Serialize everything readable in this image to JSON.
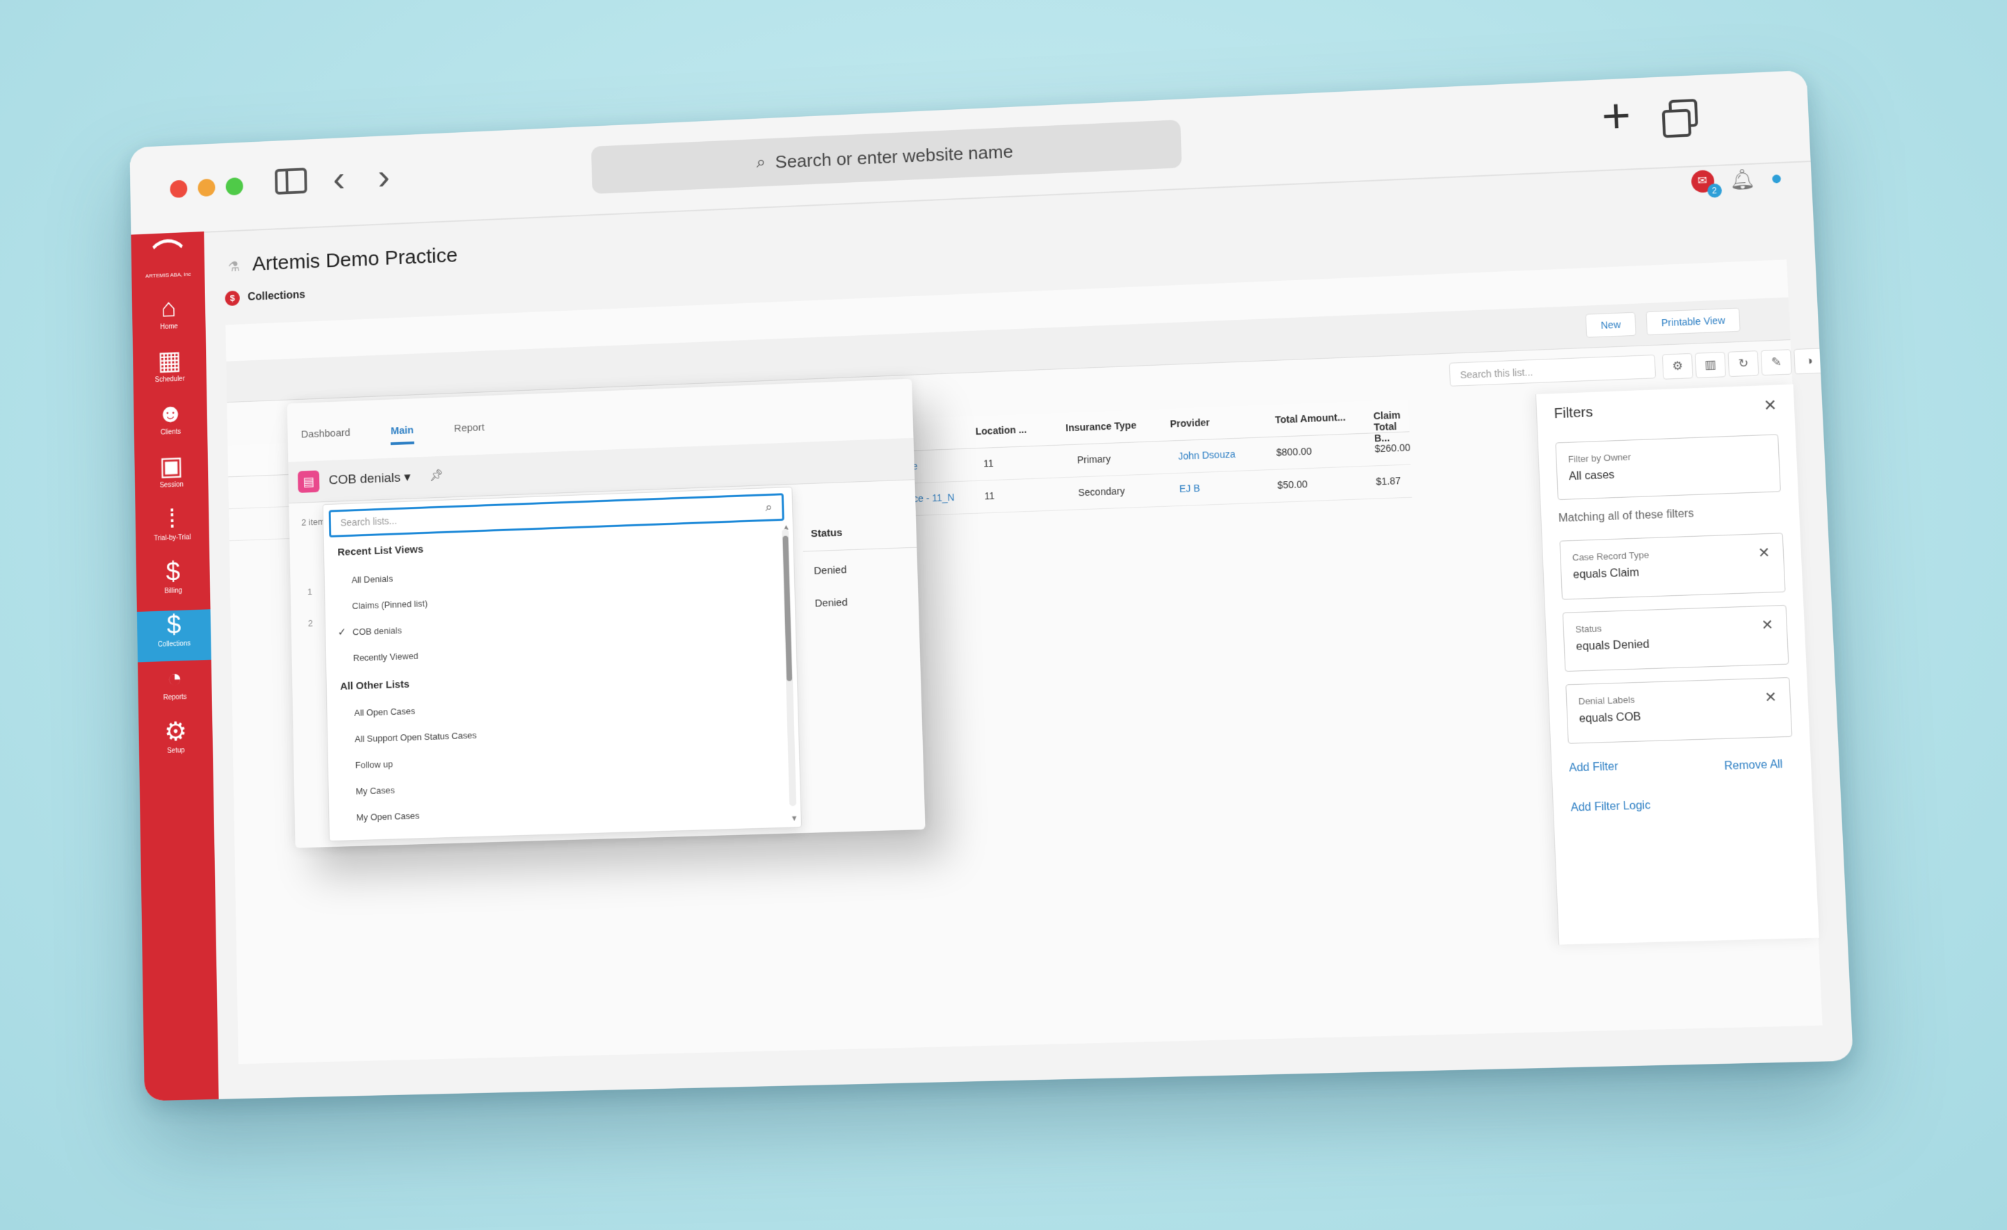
{
  "browser": {
    "url_placeholder": "Search or enter website name",
    "new_tab_icon": "plus-icon",
    "tabs_icon": "tabs-overview-icon"
  },
  "app": {
    "logo_text": "ARTEMIS ABA, Inc",
    "practice_name": "Artemis Demo Practice",
    "breadcrumb": "Collections",
    "accent_color": "#d42a33",
    "active_color": "#2d9fd8",
    "chat_badge": "2"
  },
  "sidebar": {
    "items": [
      {
        "label": "Home",
        "icon": "home-heart-icon"
      },
      {
        "label": "Scheduler",
        "icon": "calendar-icon"
      },
      {
        "label": "Clients",
        "icon": "people-icon"
      },
      {
        "label": "Session",
        "icon": "session-icon"
      },
      {
        "label": "Trial-by-Trial",
        "icon": "footprints-icon"
      },
      {
        "label": "Billing",
        "icon": "dollar-icon"
      },
      {
        "label": "Collections",
        "icon": "collections-icon"
      },
      {
        "label": "Reports",
        "icon": "pie-chart-icon"
      },
      {
        "label": "Setup",
        "icon": "gear-icon"
      }
    ]
  },
  "tabs": [
    "Dashboard",
    "Main",
    "Report"
  ],
  "list": {
    "name": "COB denials",
    "count": "2 items •",
    "search_placeholder": "Search this list...",
    "new_label": "New",
    "printable_label": "Printable View"
  },
  "table": {
    "columns": [
      "n",
      "Location ...",
      "Insurance Type",
      "Provider",
      "Total Amount...",
      "Claim Total B..."
    ],
    "rows": [
      [
        "ce",
        "11",
        "Primary",
        "John Dsouza",
        "$800.00",
        "$260.00"
      ],
      [
        "fice - 11_N",
        "11",
        "Secondary",
        "EJ B",
        "$50.00",
        "$1.87"
      ]
    ]
  },
  "filters": {
    "title": "Filters",
    "owner_label": "Filter by Owner",
    "owner_value": "All cases",
    "matching_label": "Matching all of these filters",
    "cards": [
      {
        "label": "Case Record Type",
        "value": "equals  Claim"
      },
      {
        "label": "Status",
        "value": "equals  Denied"
      },
      {
        "label": "Denial Labels",
        "value": "equals  COB"
      }
    ],
    "add_filter": "Add Filter",
    "remove_all": "Remove All",
    "add_logic": "Add Filter Logic"
  },
  "overlay": {
    "status_header": "Status",
    "row_numbers": [
      "1",
      "2"
    ],
    "statuses": [
      "Denied",
      "Denied"
    ],
    "dropdown": {
      "search_placeholder": "Search lists...",
      "recent_header": "Recent List Views",
      "recent_items": [
        "All Denials",
        "Claims (Pinned list)",
        "COB denials",
        "Recently Viewed"
      ],
      "other_header": "All Other Lists",
      "other_items": [
        "All Open Cases",
        "All Support Open Status Cases",
        "Follow up",
        "My Cases",
        "My Open Cases"
      ]
    }
  }
}
